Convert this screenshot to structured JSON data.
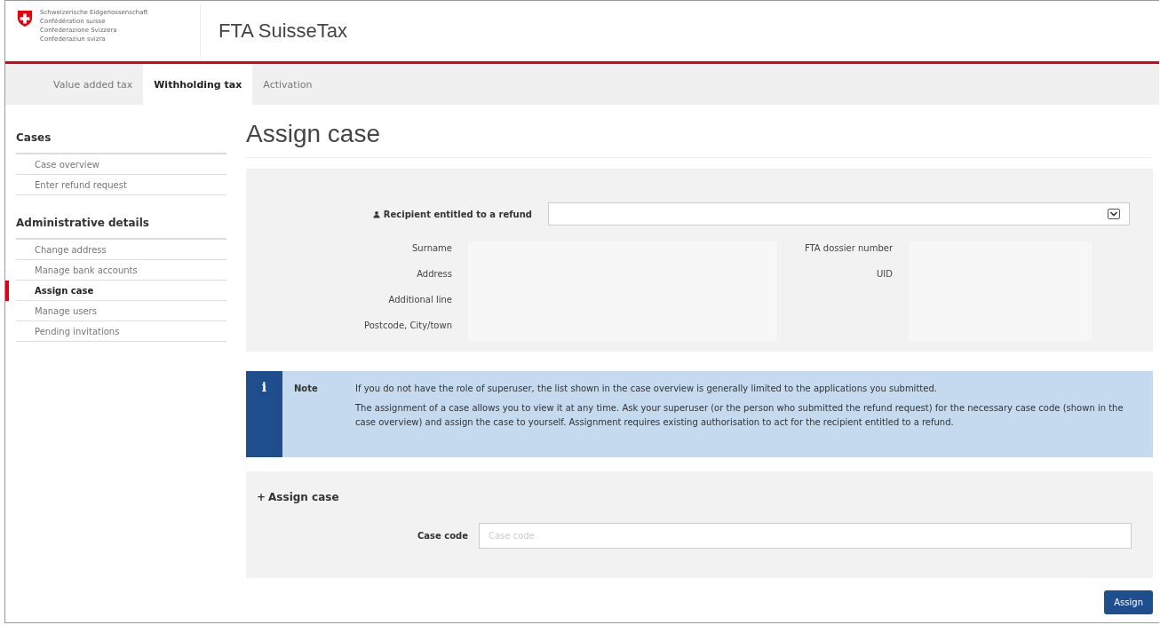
{
  "header": {
    "org_lines": [
      "Schweizerische Eidgenossenschaft",
      "Confédération suisse",
      "Confederazione Svizzera",
      "Confederaziun svizra"
    ],
    "app_title": "FTA SuisseTax"
  },
  "tabs": [
    {
      "label": "Value added tax",
      "selected": false
    },
    {
      "label": "Withholding tax",
      "selected": true
    },
    {
      "label": "Activation",
      "selected": false
    }
  ],
  "sidebar": {
    "sections": [
      {
        "title": "Cases",
        "items": [
          {
            "label": "Case overview",
            "selected": false
          },
          {
            "label": "Enter refund request",
            "selected": false
          }
        ]
      },
      {
        "title": "Administrative details",
        "items": [
          {
            "label": "Change address",
            "selected": false
          },
          {
            "label": "Manage bank accounts",
            "selected": false
          },
          {
            "label": "Assign case",
            "selected": true
          },
          {
            "label": "Manage users",
            "selected": false
          },
          {
            "label": "Pending invitations",
            "selected": false
          }
        ]
      }
    ]
  },
  "page_title": "Assign case",
  "recipient": {
    "label": "Recipient entitled to a refund",
    "left_fields": [
      "Surname",
      "Address",
      "Additional line",
      "Postcode, City/town"
    ],
    "right_fields": [
      "FTA dossier number",
      "UID"
    ]
  },
  "note": {
    "title": "Note",
    "icon": "i",
    "paragraphs": [
      "If you do not have the role of superuser, the list shown in the case overview is generally limited to the applications you submitted.",
      "The assignment of a case allows you to view it at any time. Ask your superuser (or the person who submitted the refund request) for the necessary case code (shown in the case overview) and assign the case to yourself. Assignment requires existing authorisation to act for the recipient entitled to a refund."
    ]
  },
  "assign": {
    "icon": "+",
    "title": "Assign case",
    "field_label": "Case code",
    "placeholder": "Case code"
  },
  "buttons": [
    "Assign"
  ]
}
